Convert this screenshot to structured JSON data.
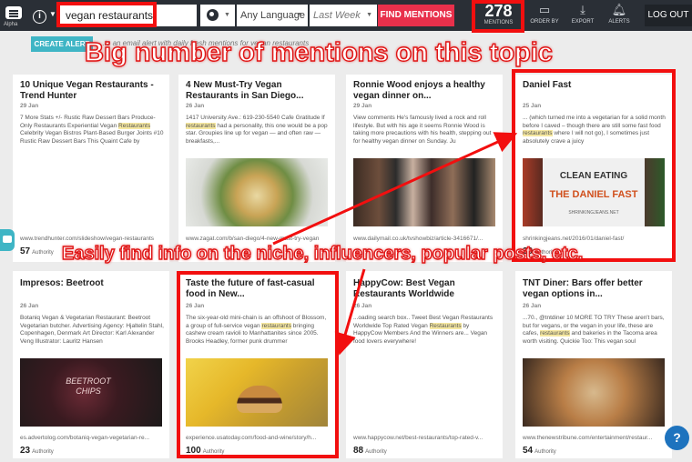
{
  "topbar": {
    "menu_tiny_label": "Alpha",
    "search_value": "vegan restaurants",
    "language": "Any Language",
    "date_range": "Last Week",
    "find_button": "FIND MENTIONS",
    "mentions_count": "278",
    "mentions_label": "MENTIONS",
    "tools": [
      {
        "label": "ORDER BY",
        "icon": "monitor-icon"
      },
      {
        "label": "EXPORT",
        "icon": "download-icon"
      },
      {
        "label": "ALERTS",
        "icon": "bell-icon"
      }
    ],
    "logout": "LOG OUT"
  },
  "alert_bar": {
    "button": "CREATE ALERT",
    "hint": "...te an email alert with daily fresh mentions for vegan restaurants"
  },
  "annotations": {
    "headline": "Big number of mentions on this topic",
    "subline": "Easily find info on the niche, influencers, popular posts, etc."
  },
  "cards": [
    {
      "title": "10 Unique Vegan Restaurants - Trend Hunter",
      "date": "29 Jan",
      "snippet_before": "7 More Stats +/- Rustic Raw Dessert Bars Produce-Only Restaurants Experiential Vegan ",
      "snippet_highlight": "Restaurants",
      "snippet_after": " Celebrity Vegan Bistros Plant-Based Burger Joints #10 Rustic Raw Dessert Bars This Quaint Cafe by",
      "url": "www.trendhunter.com/slideshow/vegan-restaurants",
      "authority": "57",
      "authority_label": "Authority",
      "image": "none"
    },
    {
      "title": "4 New Must-Try Vegan Restaurants in San Diego...",
      "date": "26 Jan",
      "snippet_before": "1417 University Ave.: 619-230-5540 Cafe Gratitude If ",
      "snippet_highlight": "restaurants",
      "snippet_after": " had a personality, this one would be a pop star. Groupies line up for vegan — and often raw — breakfasts,...",
      "url": "www.zagat.com/b/san-diego/4-new-must-try-vegan",
      "authority": "",
      "authority_label": "",
      "image": "food-photo"
    },
    {
      "title": "Ronnie Wood enjoys a healthy vegan dinner on...",
      "date": "29 Jan",
      "snippet_before": "View comments He's famously lived a rock and roll lifestyle. But with his age it seems Ronnie Wood is taking more precautions with his health, stepping out for healthy vegan dinner on Sunday. Ju",
      "snippet_highlight": "",
      "snippet_after": "",
      "url": "www.dailymail.co.uk/tvshowbiz/article-3416671/...",
      "authority": "",
      "authority_label": "",
      "image": "crowd-photo"
    },
    {
      "title": "Daniel Fast",
      "date": "25 Jan",
      "snippet_before": "... (which turned me into a vegetarian for a solid month before I caved – though there are still some fast food ",
      "snippet_highlight": "restaurants",
      "snippet_after": " where I will not go), I sometimes just absolutely crave a juicy",
      "url": "shrinkingjeans.net/2016/01/daniel-fast/",
      "authority": "30",
      "authority_label": "Authority",
      "image": "daniel-fast",
      "image_text": [
        "CLEAN EATING",
        "THE DANIEL FAST",
        "SHRINKINGJEANS.NET"
      ]
    },
    {
      "title": "Impresos: Beetroot",
      "date": "26 Jan",
      "snippet_before": "Botaniq Vegan & Vegetarian Restaurant: Beetroot Vegetarian butcher. Advertising Agency: Hjaltelin Stahl, Copenhagen, Denmark Art Director: Karl Alexander Veng Illustrator: Lauritz Hansen",
      "snippet_highlight": "",
      "snippet_after": "",
      "url": "es.advertolog.com/botaniq-vegan-vegetarian-re...",
      "authority": "23",
      "authority_label": "Authority",
      "image": "beet",
      "image_text": "BEETROOT CHIPS"
    },
    {
      "title": "Taste the future of fast-casual food in New...",
      "date": "26 Jan",
      "snippet_before": "The six-year-old mini-chain is an offshoot of Blossom, a group of full-service vegan ",
      "snippet_highlight": "restaurants",
      "snippet_after": " bringing cashew cream ravioli to Manhattanites since 2005. Brooks Headley, former punk drummer",
      "url": "experience.usatoday.com/food-and-wine/story/h...",
      "authority": "100",
      "authority_label": "Authority",
      "image": "burger"
    },
    {
      "title": "HappyCow: Best Vegan Restaurants Worldwide",
      "date": "26 Jan",
      "snippet_before": "...oading search box.. Tweet Best Vegan Restaurants Worldwide Top Rated Vegan ",
      "snippet_highlight": "Restaurants",
      "snippet_after": " by HappyCow Members And the Winners are... Vegan food lovers everywhere!",
      "url": "www.happycow.net/best-restaurants/top-rated-v...",
      "authority": "88",
      "authority_label": "Authority",
      "image": "blank"
    },
    {
      "title": "TNT Diner: Bars offer better vegan options in...",
      "date": "26 Jan",
      "snippet_before": "...70., @tntdiner 10 MORE TO TRY These aren't bars, but for vegans, or the vegan in your life, these are cafes, ",
      "snippet_highlight": "restaurants",
      "snippet_after": " and bakeries in the Tacoma area worth visiting. Quickie Too: This vegan soul",
      "url": "www.thenewstribune.com/entertainment/restaur...",
      "authority": "54",
      "authority_label": "Authority",
      "image": "hotdog"
    }
  ]
}
